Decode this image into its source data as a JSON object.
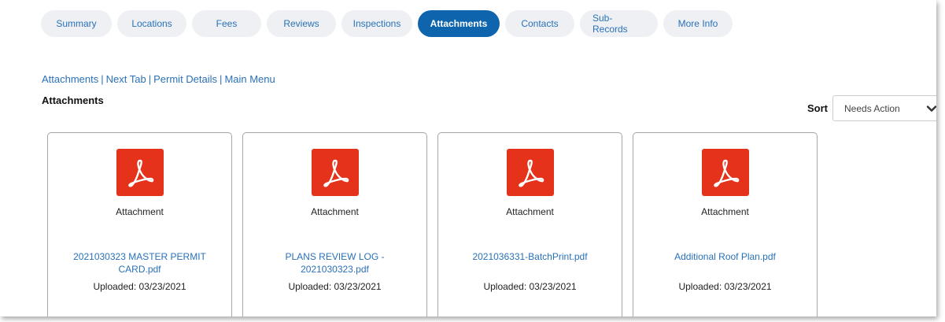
{
  "tabs": [
    {
      "label": "Summary",
      "active": false
    },
    {
      "label": "Locations",
      "active": false
    },
    {
      "label": "Fees",
      "active": false
    },
    {
      "label": "Reviews",
      "active": false
    },
    {
      "label": "Inspections",
      "active": false
    },
    {
      "label": "Attachments",
      "active": true
    },
    {
      "label": "Contacts",
      "active": false
    },
    {
      "label": "Sub-Records",
      "active": false
    },
    {
      "label": "More Info",
      "active": false
    }
  ],
  "breadcrumb": {
    "items": [
      "Attachments",
      "Next Tab",
      "Permit Details",
      "Main Menu"
    ],
    "separator": "|"
  },
  "section_title": "Attachments",
  "sort": {
    "label": "Sort",
    "selected": "Needs Action"
  },
  "cards": [
    {
      "icon": "pdf-icon",
      "type": "Attachment",
      "file_name": "2021030323 MASTER PERMIT CARD.pdf",
      "uploaded": "Uploaded: 03/23/2021"
    },
    {
      "icon": "pdf-icon",
      "type": "Attachment",
      "file_name": "PLANS REVIEW LOG - 2021030323.pdf",
      "uploaded": "Uploaded: 03/23/2021"
    },
    {
      "icon": "pdf-icon",
      "type": "Attachment",
      "file_name": "2021036331-BatchPrint.pdf",
      "uploaded": "Uploaded: 03/23/2021"
    },
    {
      "icon": "pdf-icon",
      "type": "Attachment",
      "file_name": "Additional Roof Plan.pdf",
      "uploaded": "Uploaded: 03/23/2021"
    }
  ],
  "colors": {
    "accent": "#0e64ad",
    "link": "#2a71b8",
    "tab_bg": "#eef0f3",
    "pdf_red": "#e4321b"
  }
}
